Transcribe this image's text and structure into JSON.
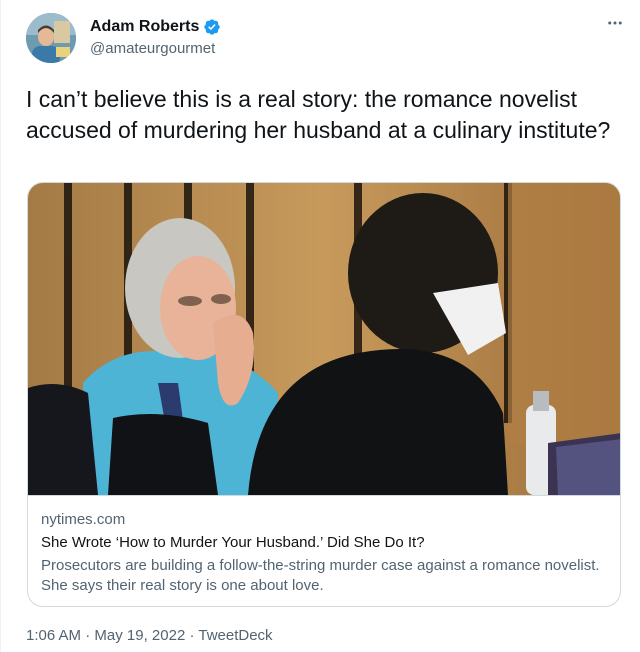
{
  "author": {
    "name": "Adam Roberts",
    "handle": "@amateurgourmet"
  },
  "icons": {
    "more": "more-horizontal-icon",
    "verified": "verified-badge-icon"
  },
  "tweet": {
    "text": "I can’t believe this is a real story: the romance novelist accused of murdering her husband at a culinary institute?"
  },
  "card": {
    "domain": "nytimes.com",
    "title": "She Wrote ‘How to Murder Your Husband.’ Did She Do It?",
    "description": "Prosecutors are building a follow-the-string murder case against a romance novelist. She says their real story is one about love."
  },
  "meta": {
    "time": "1:06 AM",
    "sep1": " · ",
    "date": "May 19, 2022",
    "sep2": " · ",
    "source": "TweetDeck"
  },
  "colors": {
    "verified": "#1d9bf0",
    "secondary_text": "#536471",
    "border": "#cfd9de"
  }
}
